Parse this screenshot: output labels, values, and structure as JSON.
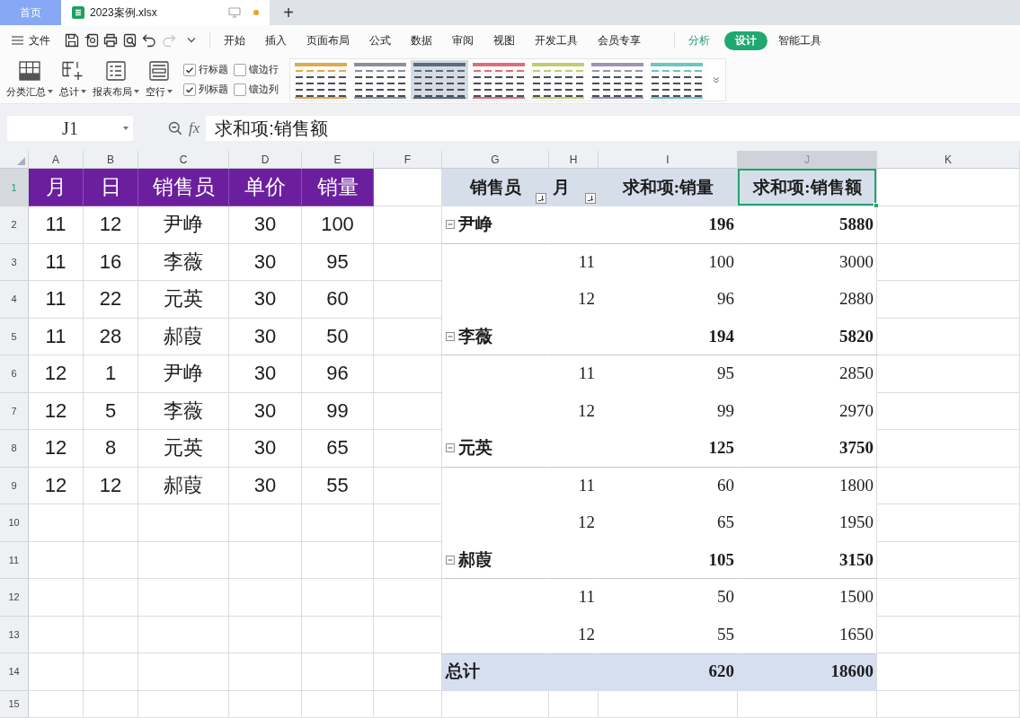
{
  "tab_bar": {
    "tabs": [
      {
        "kind": "home",
        "label": "首页",
        "selected": false
      },
      {
        "kind": "workbook",
        "label": "2023案例.xlsx",
        "selected": true,
        "modified": true
      }
    ],
    "new_tab": "+"
  },
  "menu_bar": {
    "file_menu": "文件",
    "quick_access": [
      {
        "disabled": false
      },
      {
        "disabled": false
      },
      {
        "disabled": false
      },
      {
        "disabled": false
      },
      {
        "disabled": false
      },
      {
        "disabled": true
      }
    ],
    "tabs": [
      {
        "label": "开始",
        "kind": "main",
        "selected": false
      },
      {
        "label": "插入",
        "kind": "main",
        "selected": false
      },
      {
        "label": "页面布局",
        "kind": "main",
        "selected": false
      },
      {
        "label": "公式",
        "kind": "main",
        "selected": false
      },
      {
        "label": "数据",
        "kind": "main",
        "selected": false
      },
      {
        "label": "审阅",
        "kind": "main",
        "selected": false
      },
      {
        "label": "视图",
        "kind": "main",
        "selected": false
      },
      {
        "label": "开发工具",
        "kind": "main",
        "selected": false
      },
      {
        "label": "会员专享",
        "kind": "main",
        "selected": false
      },
      {
        "label": "分析",
        "kind": "context",
        "selected": false
      },
      {
        "label": "设计",
        "kind": "context",
        "selected": true
      },
      {
        "label": "智能工具",
        "kind": "main",
        "selected": false
      }
    ]
  },
  "ribbon": {
    "buttons": [
      {
        "label": "分类汇总"
      },
      {
        "label": "总计"
      },
      {
        "label": "报表布局"
      },
      {
        "label": "空行"
      }
    ],
    "options": [
      {
        "label": "行标题",
        "checked": true
      },
      {
        "label": "镶边行",
        "checked": false
      },
      {
        "label": "列标题",
        "checked": true
      },
      {
        "label": "镶边列",
        "checked": false
      }
    ],
    "styles": [
      {
        "color": "#e0a94a",
        "selected": false
      },
      {
        "color": "#8a9099",
        "selected": false
      },
      {
        "color": "#5d6b7d",
        "selected": true
      },
      {
        "color": "#d9707a",
        "selected": false
      },
      {
        "color": "#c2cc6e",
        "selected": false
      },
      {
        "color": "#9d93b3",
        "selected": false
      },
      {
        "color": "#6cc6c0",
        "selected": false
      }
    ]
  },
  "formula_bar": {
    "cell_ref": "J1",
    "fx": "fx",
    "formula": "求和项:销售额"
  },
  "sheet": {
    "columns": [
      {
        "label": "A",
        "selected": false
      },
      {
        "label": "B",
        "selected": false
      },
      {
        "label": "C",
        "selected": false
      },
      {
        "label": "D",
        "selected": false
      },
      {
        "label": "E",
        "selected": false
      },
      {
        "label": "F",
        "selected": false
      },
      {
        "label": "G",
        "selected": false
      },
      {
        "label": "H",
        "selected": false
      },
      {
        "label": "I",
        "selected": false
      },
      {
        "label": "J",
        "selected": true
      },
      {
        "label": "K",
        "selected": false
      }
    ],
    "rows": [
      {
        "label": "1",
        "selected": true
      },
      {
        "label": "2",
        "selected": false
      },
      {
        "label": "3",
        "selected": false
      },
      {
        "label": "4",
        "selected": false
      },
      {
        "label": "5",
        "selected": false
      },
      {
        "label": "6",
        "selected": false
      },
      {
        "label": "7",
        "selected": false
      },
      {
        "label": "8",
        "selected": false
      },
      {
        "label": "9",
        "selected": false
      },
      {
        "label": "10",
        "selected": false
      },
      {
        "label": "11",
        "selected": false
      },
      {
        "label": "12",
        "selected": false
      },
      {
        "label": "13",
        "selected": false
      },
      {
        "label": "14",
        "selected": false
      },
      {
        "label": "15",
        "selected": false
      }
    ],
    "source_table": {
      "header": [
        "月",
        "日",
        "销售员",
        "单价",
        "销量"
      ],
      "rows": [
        [
          "11",
          "12",
          "尹峥",
          "30",
          "100"
        ],
        [
          "11",
          "16",
          "李薇",
          "30",
          "95"
        ],
        [
          "11",
          "22",
          "元英",
          "30",
          "60"
        ],
        [
          "11",
          "28",
          "郝葭",
          "30",
          "50"
        ],
        [
          "12",
          "1",
          "尹峥",
          "30",
          "96"
        ],
        [
          "12",
          "5",
          "李薇",
          "30",
          "99"
        ],
        [
          "12",
          "8",
          "元英",
          "30",
          "65"
        ],
        [
          "12",
          "12",
          "郝葭",
          "30",
          "55"
        ]
      ]
    },
    "pivot": {
      "header": [
        {
          "label": "销售员",
          "filter": true,
          "selected": false
        },
        {
          "label": "月",
          "filter": true,
          "selected": false
        },
        {
          "label": "求和项:销量",
          "filter": false,
          "selected": false
        },
        {
          "label": "求和项:销售额",
          "filter": false,
          "selected": true
        }
      ],
      "groups": [
        {
          "name": "尹峥",
          "expanded": true,
          "qty": "196",
          "amount": "5880",
          "children": [
            {
              "month": "11",
              "qty": "100",
              "amount": "3000"
            },
            {
              "month": "12",
              "qty": "96",
              "amount": "2880"
            }
          ]
        },
        {
          "name": "李薇",
          "expanded": true,
          "qty": "194",
          "amount": "5820",
          "children": [
            {
              "month": "11",
              "qty": "95",
              "amount": "2850"
            },
            {
              "month": "12",
              "qty": "99",
              "amount": "2970"
            }
          ]
        },
        {
          "name": "元英",
          "expanded": true,
          "qty": "125",
          "amount": "3750",
          "children": [
            {
              "month": "11",
              "qty": "60",
              "amount": "1800"
            },
            {
              "month": "12",
              "qty": "65",
              "amount": "1950"
            }
          ]
        },
        {
          "name": "郝葭",
          "expanded": true,
          "qty": "105",
          "amount": "3150",
          "children": [
            {
              "month": "11",
              "qty": "50",
              "amount": "1500"
            },
            {
              "month": "12",
              "qty": "55",
              "amount": "1650"
            }
          ]
        }
      ],
      "total": {
        "label": "总计",
        "qty": "620",
        "amount": "18600"
      }
    }
  }
}
